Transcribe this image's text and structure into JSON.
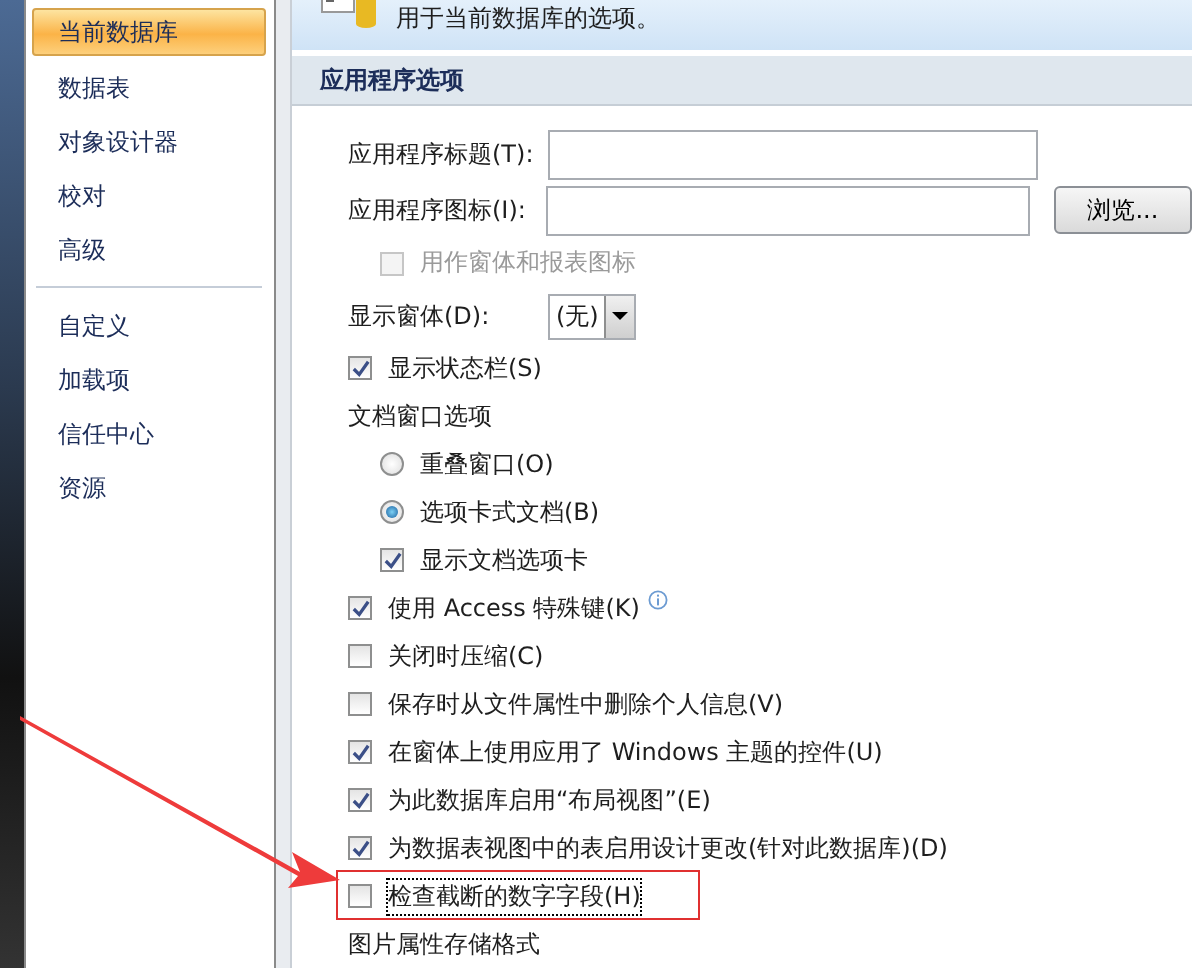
{
  "sidebar": {
    "items": [
      {
        "label": "当前数据库",
        "selected": true
      },
      {
        "label": "数据表",
        "selected": false
      },
      {
        "label": "对象设计器",
        "selected": false
      },
      {
        "label": "校对",
        "selected": false
      },
      {
        "label": "高级",
        "selected": false
      },
      {
        "label": "自定义",
        "selected": false,
        "separator_before": true
      },
      {
        "label": "加载项",
        "selected": false
      },
      {
        "label": "信任中心",
        "selected": false
      },
      {
        "label": "资源",
        "selected": false
      }
    ]
  },
  "header": {
    "text": "用于当前数据库的选项。"
  },
  "section": {
    "title": "应用程序选项"
  },
  "fields": [
    {
      "label": "应用程序标题(T):"
    },
    {
      "label": "应用程序图标(I):",
      "button": "浏览..."
    }
  ],
  "icon_checkbox": {
    "label": "用作窗体和报表图标",
    "checked": false,
    "disabled": true
  },
  "display_form": {
    "label": "显示窗体(D):",
    "value": "(无)"
  },
  "options": [
    {
      "kind": "checkbox",
      "label": "显示状态栏(S)",
      "checked": true
    },
    {
      "kind": "group",
      "label": "文档窗口选项",
      "children": [
        {
          "kind": "radio",
          "label": "重叠窗口(O)",
          "selected": false
        },
        {
          "kind": "radio",
          "label": "选项卡式文档(B)",
          "selected": true
        },
        {
          "kind": "checkbox",
          "label": "显示文档选项卡",
          "checked": true
        }
      ]
    },
    {
      "kind": "checkbox",
      "label": "使用 Access 特殊键(K)",
      "checked": true,
      "info": true
    },
    {
      "kind": "checkbox",
      "label": "关闭时压缩(C)",
      "checked": false
    },
    {
      "kind": "checkbox",
      "label": "保存时从文件属性中删除个人信息(V)",
      "checked": false
    },
    {
      "kind": "checkbox",
      "label": "在窗体上使用应用了 Windows 主题的控件(U)",
      "checked": true
    },
    {
      "kind": "checkbox",
      "label": "为此数据库启用“布局视图”(E)",
      "checked": true
    },
    {
      "kind": "checkbox",
      "label": "为数据表视图中的表启用设计更改(针对此数据库)(D)",
      "checked": true
    },
    {
      "kind": "checkbox",
      "label": "检查截断的数字字段(H)",
      "checked": false,
      "highlighted": true
    },
    {
      "kind": "group",
      "label": "图片属性存储格式"
    }
  ]
}
